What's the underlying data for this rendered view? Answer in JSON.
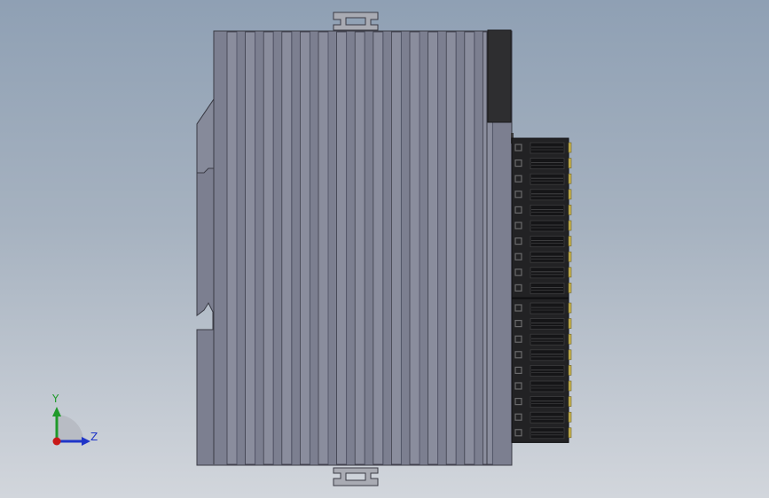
{
  "viewport": {
    "background_top": "#8fa0b4",
    "background_bottom": "#d2d6dc"
  },
  "model": {
    "body_color": "#7c7f90",
    "rib_color": "#8a8d9d",
    "rib_edge_color": "#3c3e4a",
    "outline_color": "#3a3b45",
    "clip_color": "#a9abb3",
    "cover_color": "#2e2e30",
    "connector_color": "#222224",
    "pin_color": "#c8b450",
    "slot_color": "#6a6a6c",
    "connector_blocks": [
      {
        "name": "upper-terminal-block",
        "pin_count": 10
      },
      {
        "name": "lower-terminal-block",
        "pin_count": 9
      }
    ]
  },
  "triad": {
    "y_label": "Y",
    "z_label": "Z",
    "y_color": "#1f9a2a",
    "z_color": "#1f35c8",
    "x_color": "#c81818"
  }
}
